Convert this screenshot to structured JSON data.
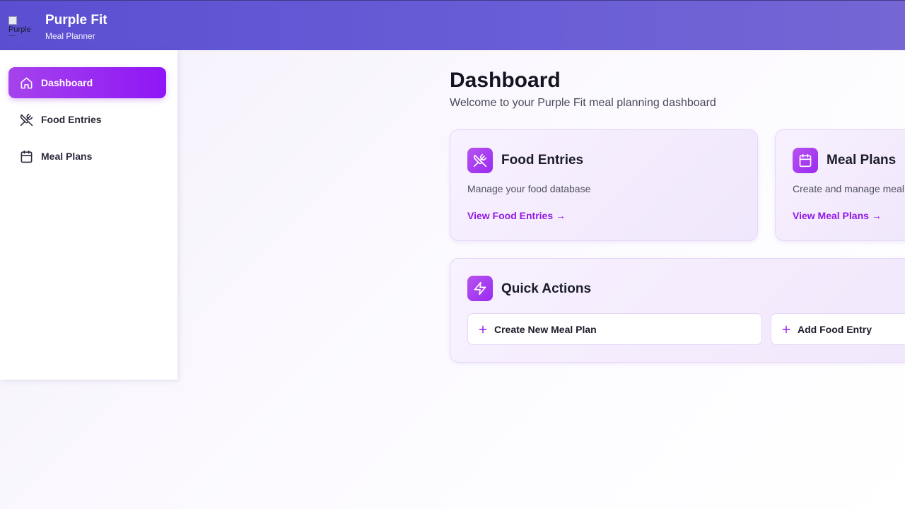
{
  "header": {
    "logo_alt": "Purple Fit",
    "title": "Purple Fit",
    "subtitle": "Meal Planner"
  },
  "sidebar": {
    "items": [
      {
        "label": "Dashboard",
        "icon": "home-icon",
        "active": true
      },
      {
        "label": "Food Entries",
        "icon": "utensils-crossed-icon",
        "active": false
      },
      {
        "label": "Meal Plans",
        "icon": "calendar-icon",
        "active": false
      }
    ]
  },
  "main": {
    "title": "Dashboard",
    "subtitle": "Welcome to your Purple Fit meal planning dashboard",
    "cards": [
      {
        "title": "Food Entries",
        "description": "Manage your food database",
        "link": "View Food Entries →",
        "icon": "utensils-crossed-icon"
      },
      {
        "title": "Meal Plans",
        "description": "Create and manage meal plans",
        "link": "View Meal Plans →",
        "icon": "calendar-icon"
      }
    ],
    "quick_actions": {
      "title": "Quick Actions",
      "icon": "zap-icon",
      "buttons": [
        {
          "label": "Create New Meal Plan",
          "icon": "plus-icon"
        },
        {
          "label": "Add Food Entry",
          "icon": "plus-icon"
        }
      ]
    }
  },
  "colors": {
    "header_start": "#5a4fd1",
    "header_end": "#7566d4",
    "accent": "#9218e6",
    "active_nav_start": "#a543ec",
    "active_nav_end": "#8f16f6"
  }
}
